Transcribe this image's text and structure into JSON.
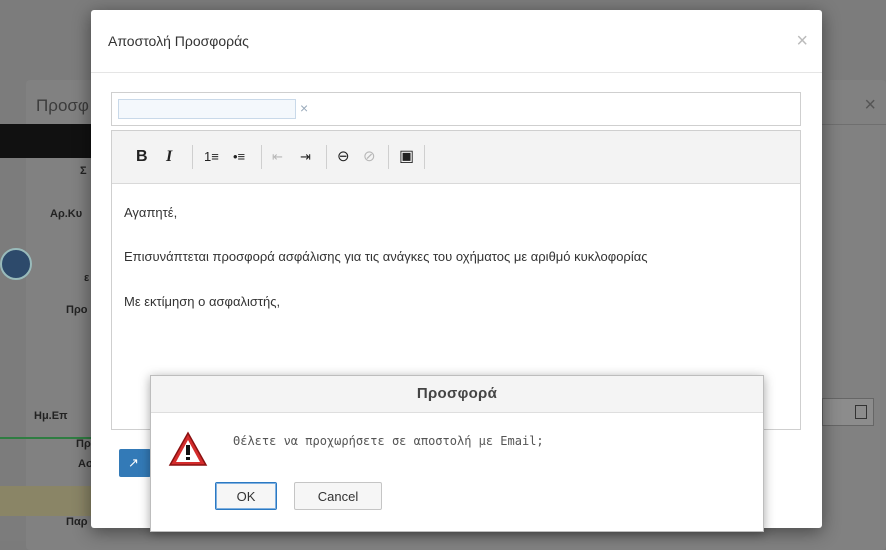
{
  "background": {
    "dialog_title": "Προσφ",
    "labels": [
      "Σ",
      "Αρ.Κυ",
      "ε",
      "Προ",
      "Ημ.Επ",
      "Πρ",
      "Ασ",
      "Παρ"
    ],
    "close_glyph": "×"
  },
  "modal": {
    "title": "Αποστολή Προσφοράς",
    "close_glyph": "×",
    "recipient": {
      "value": "",
      "clear_glyph": "×"
    },
    "toolbar": {
      "bold": "B",
      "italic": "I",
      "ordered_list": "1≡",
      "unordered_list": "•≡",
      "outdent": "⇤",
      "indent": "⇥",
      "link": "⊖",
      "unlink": "⊘",
      "image": "▣"
    },
    "body": {
      "greeting": "Αγαπητέ,",
      "line1": "Επισυνάπτεται προσφορά ασφάλισης για τις ανάγκες του οχήματος με αριθμό κυκλοφορίας",
      "signoff": "Με εκτίμηση ο ασφαλιστής,"
    },
    "send_icon": "↗"
  },
  "confirm": {
    "title": "Προσφορά",
    "message": "Θέλετε να προχωρήσετε σε αποστολή με Email;",
    "ok_label": "OK",
    "cancel_label": "Cancel"
  }
}
